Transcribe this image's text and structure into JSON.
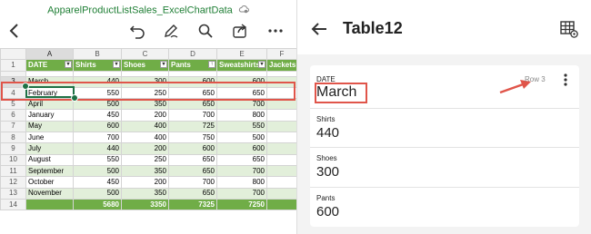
{
  "excel": {
    "file_title": "ApparelProductListSales_ExcelChartData",
    "toolbar_icons": [
      "back-chevron-icon",
      "undo-icon",
      "draw-pen-icon",
      "search-icon",
      "share-icon",
      "more-icon"
    ],
    "col_letters": [
      "A",
      "B",
      "C",
      "D",
      "E",
      "F"
    ],
    "headers": [
      "DATE",
      "Shirts",
      "Shoes",
      "Pants",
      "Sweatshirts",
      "Jackets"
    ],
    "rows": [
      {
        "num": "1",
        "cells": []
      },
      {
        "num": "3",
        "cells": [
          "March",
          "440",
          "300",
          "600",
          "600",
          ""
        ]
      },
      {
        "num": "4",
        "cells": [
          "February",
          "550",
          "250",
          "650",
          "650",
          ""
        ]
      },
      {
        "num": "5",
        "cells": [
          "April",
          "500",
          "350",
          "650",
          "700",
          ""
        ]
      },
      {
        "num": "6",
        "cells": [
          "January",
          "450",
          "200",
          "700",
          "800",
          ""
        ]
      },
      {
        "num": "7",
        "cells": [
          "May",
          "600",
          "400",
          "725",
          "550",
          ""
        ]
      },
      {
        "num": "8",
        "cells": [
          "June",
          "700",
          "400",
          "750",
          "500",
          ""
        ]
      },
      {
        "num": "9",
        "cells": [
          "July",
          "440",
          "200",
          "600",
          "600",
          ""
        ]
      },
      {
        "num": "10",
        "cells": [
          "August",
          "550",
          "250",
          "650",
          "650",
          ""
        ]
      },
      {
        "num": "11",
        "cells": [
          "September",
          "500",
          "350",
          "650",
          "700",
          ""
        ]
      },
      {
        "num": "12",
        "cells": [
          "October",
          "450",
          "200",
          "700",
          "800",
          ""
        ]
      },
      {
        "num": "13",
        "cells": [
          "November",
          "500",
          "350",
          "650",
          "700",
          ""
        ]
      },
      {
        "num": "14",
        "cells": [
          "",
          "5680",
          "3350",
          "7325",
          "7250",
          ""
        ]
      }
    ],
    "selected_row": "3",
    "active_cell": "A3"
  },
  "card_view": {
    "title": "Table12",
    "date_label": "DATE",
    "date_value": "March",
    "row_tag": "Row 3",
    "fields": [
      {
        "label": "Shirts",
        "value": "440"
      },
      {
        "label": "Shoes",
        "value": "300"
      },
      {
        "label": "Pants",
        "value": "600"
      }
    ]
  },
  "colors": {
    "table_header_green": "#70ad47",
    "band_light_green": "#e2efda",
    "highlight_red": "#e0554a",
    "selection_green": "#1e7145",
    "title_green": "#1e7e34"
  }
}
